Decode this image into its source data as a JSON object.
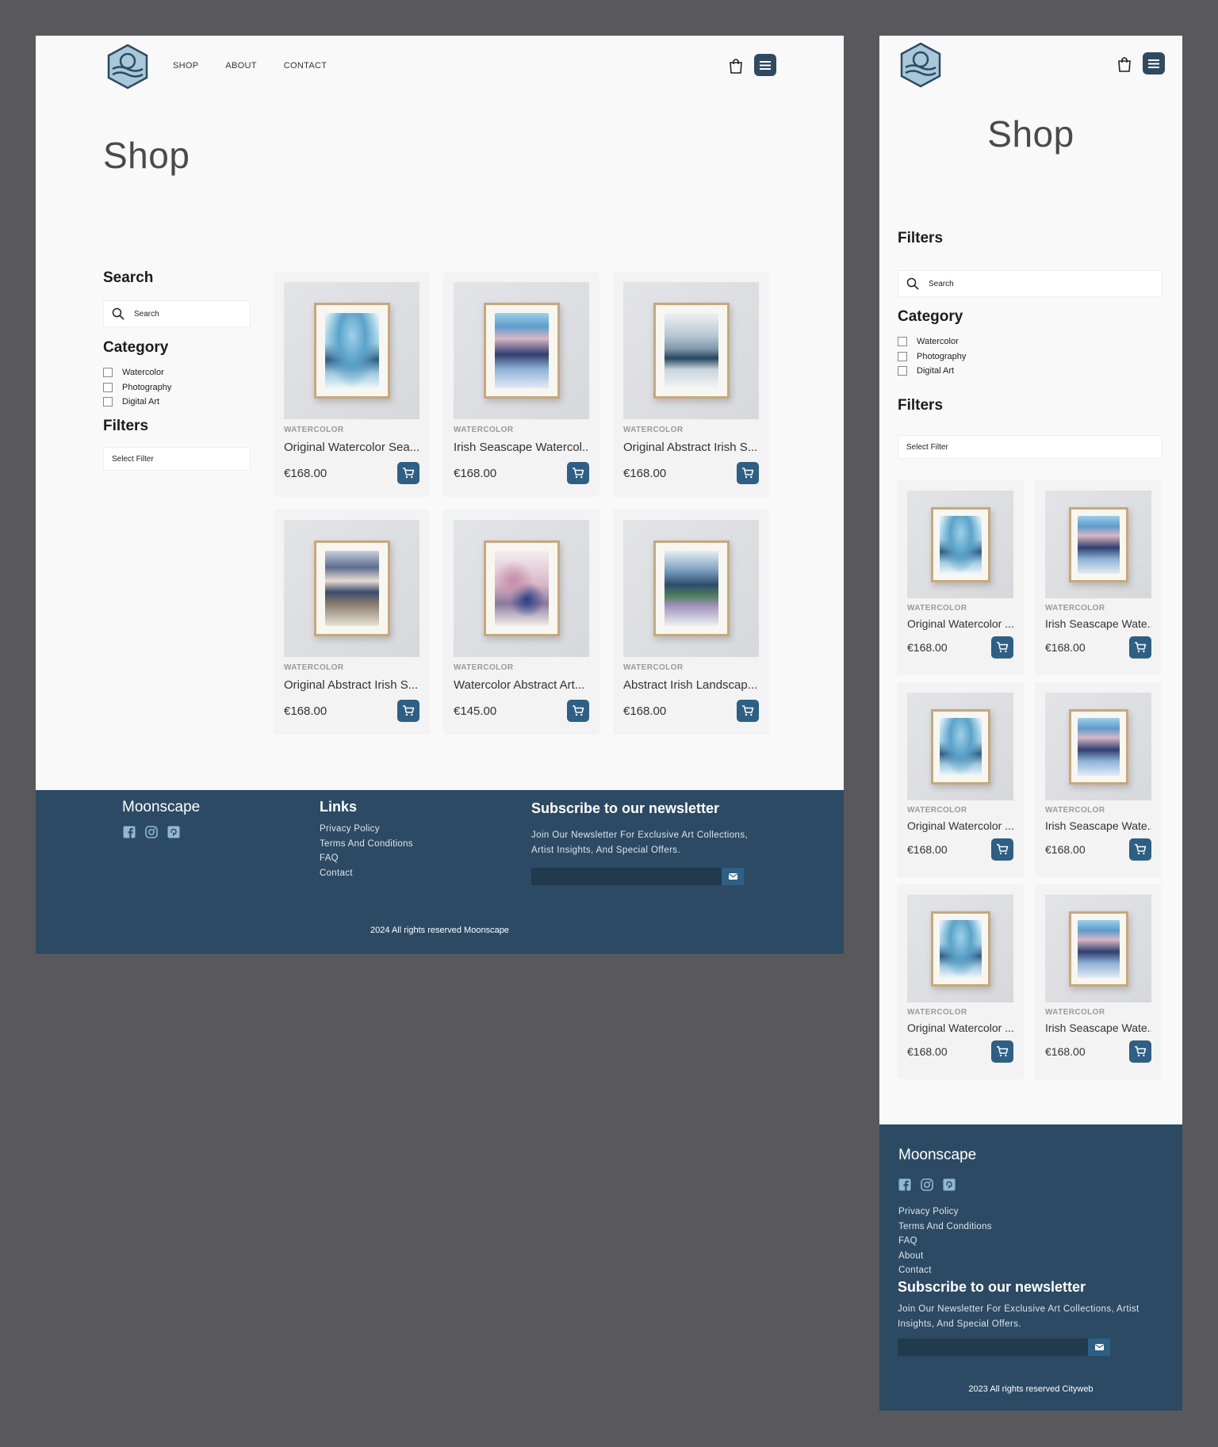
{
  "header": {
    "nav": [
      "SHOP",
      "ABOUT",
      "CONTACT"
    ]
  },
  "shop": {
    "title": "Shop"
  },
  "sidebar": {
    "search_heading": "Search",
    "search_placeholder": "Search",
    "category_heading": "Category",
    "categories": [
      "Watercolor",
      "Photography",
      "Digital Art"
    ],
    "filters_heading": "Filters",
    "filter_select": "Select Filter"
  },
  "products_desktop": [
    {
      "category": "WATERCOLOR",
      "name": "Original Watercolor Sea...",
      "price": "€168.00"
    },
    {
      "category": "WATERCOLOR",
      "name": "Irish Seascape Watercol...",
      "price": "€168.00"
    },
    {
      "category": "WATERCOLOR",
      "name": "Original Abstract Irish S...",
      "price": "€168.00"
    },
    {
      "category": "WATERCOLOR",
      "name": "Original Abstract Irish S...",
      "price": "€168.00"
    },
    {
      "category": "WATERCOLOR",
      "name": "Watercolor Abstract Art...",
      "price": "€145.00"
    },
    {
      "category": "WATERCOLOR",
      "name": "Abstract Irish Landscap...",
      "price": "€168.00"
    }
  ],
  "products_mobile": [
    {
      "category": "WATERCOLOR",
      "name": "Original Watercolor ...",
      "price": "€168.00"
    },
    {
      "category": "WATERCOLOR",
      "name": "Irish Seascape Wate...",
      "price": "€168.00"
    },
    {
      "category": "WATERCOLOR",
      "name": "Original Watercolor ...",
      "price": "€168.00"
    },
    {
      "category": "WATERCOLOR",
      "name": "Irish Seascape Wate...",
      "price": "€168.00"
    },
    {
      "category": "WATERCOLOR",
      "name": "Original Watercolor ...",
      "price": "€168.00"
    },
    {
      "category": "WATERCOLOR",
      "name": "Irish Seascape Wate...",
      "price": "€168.00"
    }
  ],
  "footer": {
    "brand": "Moonscape",
    "links_heading": "Links",
    "links_desktop": [
      "Privacy Policy",
      "Terms And Conditions",
      "FAQ",
      "Contact"
    ],
    "links_mobile": [
      "Privacy Policy",
      "Terms And Conditions",
      "FAQ",
      "About",
      "Contact"
    ],
    "newsletter_heading": "Subscribe to our newsletter",
    "newsletter_text": "Join Our Newsletter For Exclusive Art Collections, Artist Insights, And Special Offers.",
    "copyright_desktop": "2024 All rights reserved Moonscape",
    "copyright_mobile": "2023 All rights reserved Cityweb",
    "social_icons": [
      "facebook-icon",
      "instagram-icon",
      "pinterest-icon"
    ]
  },
  "colors": {
    "primary": "#2c4a63",
    "button": "#2e5f85",
    "page_bg": "#59595c",
    "card_bg": "#f3f3f3"
  }
}
